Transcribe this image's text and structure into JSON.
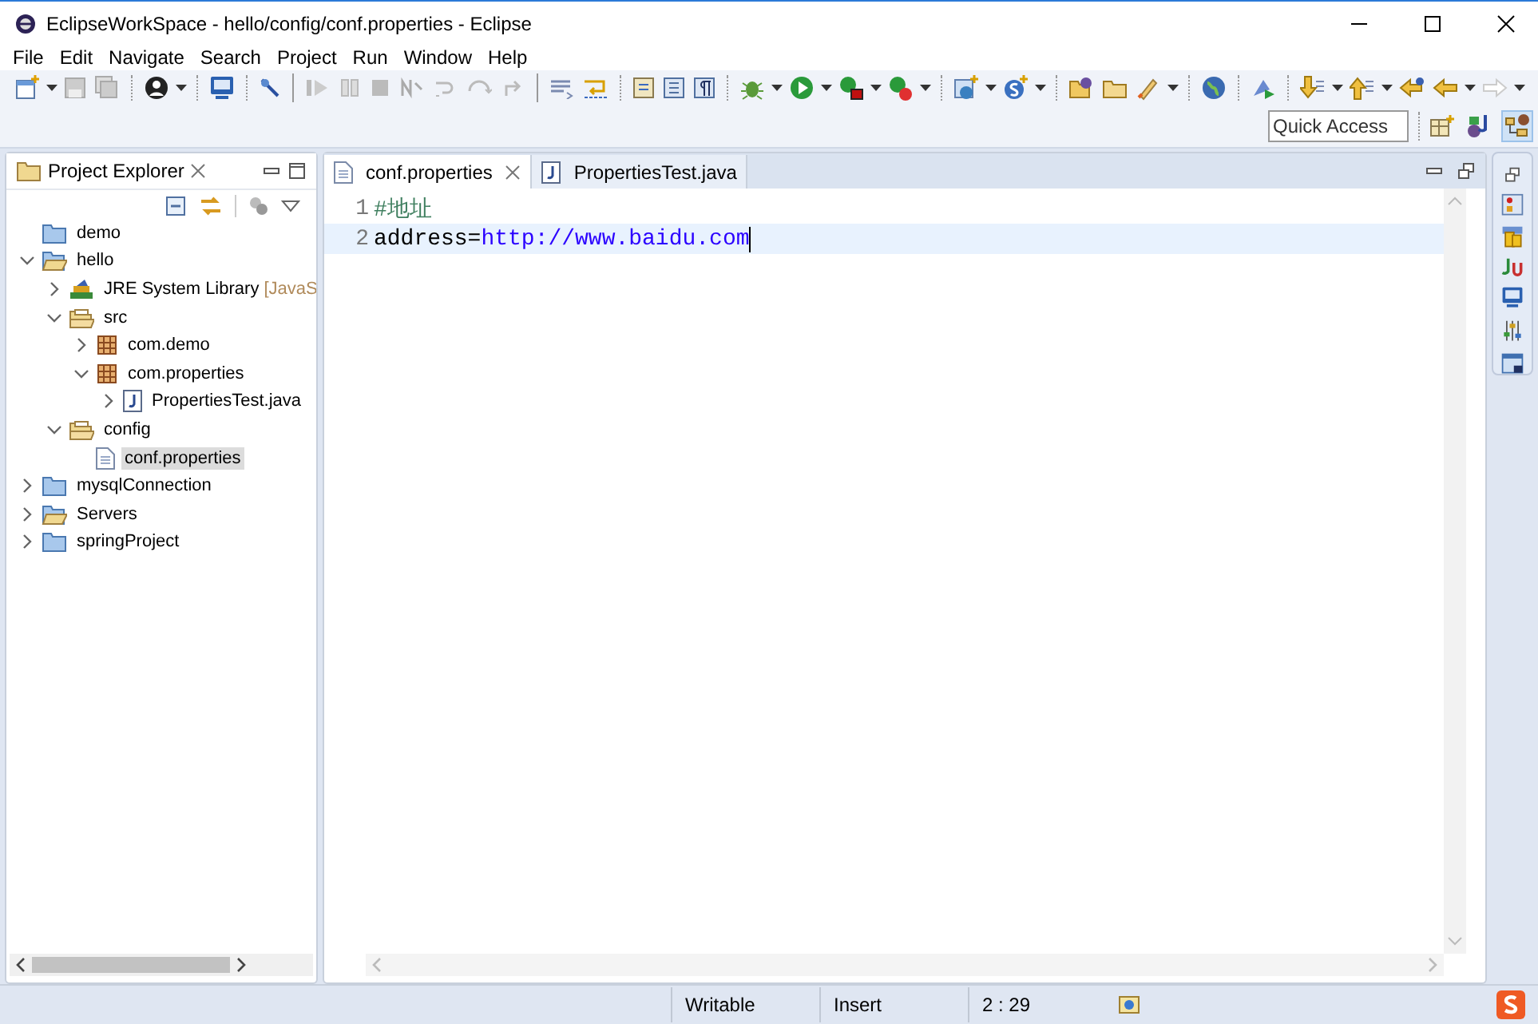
{
  "window": {
    "title": "EclipseWorkSpace - hello/config/conf.properties - Eclipse"
  },
  "menu": [
    "File",
    "Edit",
    "Navigate",
    "Search",
    "Project",
    "Run",
    "Window",
    "Help"
  ],
  "quick_access": {
    "placeholder": "Quick Access"
  },
  "project_explorer": {
    "title": "Project Explorer",
    "tree": [
      {
        "label": "demo",
        "kind": "project-closed"
      },
      {
        "label": "hello",
        "kind": "project",
        "expanded": true,
        "children": [
          {
            "label": "JRE System Library",
            "decoration": "[JavaS",
            "kind": "library",
            "expanded": false
          },
          {
            "label": "src",
            "kind": "source-folder",
            "expanded": true,
            "children": [
              {
                "label": "com.demo",
                "kind": "package",
                "expanded": false
              },
              {
                "label": "com.properties",
                "kind": "package",
                "expanded": true,
                "children": [
                  {
                    "label": "PropertiesTest.java",
                    "kind": "java-file",
                    "expanded": false
                  }
                ]
              }
            ]
          },
          {
            "label": "config",
            "kind": "source-folder",
            "expanded": true,
            "children": [
              {
                "label": "conf.properties",
                "kind": "file",
                "selected": true
              }
            ]
          }
        ]
      },
      {
        "label": "mysqlConnection",
        "kind": "project-closed",
        "expanded": false
      },
      {
        "label": "Servers",
        "kind": "project",
        "expanded": false
      },
      {
        "label": "springProject",
        "kind": "project-closed",
        "expanded": false
      }
    ]
  },
  "editor": {
    "tabs": [
      {
        "label": "conf.properties",
        "kind": "file",
        "selected": true,
        "closable": true
      },
      {
        "label": "PropertiesTest.java",
        "kind": "java-file",
        "selected": false,
        "closable": false
      }
    ],
    "lines": [
      {
        "number": "1",
        "current": false,
        "tokens": [
          {
            "kind": "comment",
            "text": "#地址"
          }
        ]
      },
      {
        "number": "2",
        "current": true,
        "tokens": [
          {
            "kind": "key",
            "text": "address="
          },
          {
            "kind": "value",
            "text": "http://www.baidu.com"
          }
        ]
      }
    ]
  },
  "status_bar": [
    "Writable",
    "Insert",
    "2 : 29"
  ]
}
